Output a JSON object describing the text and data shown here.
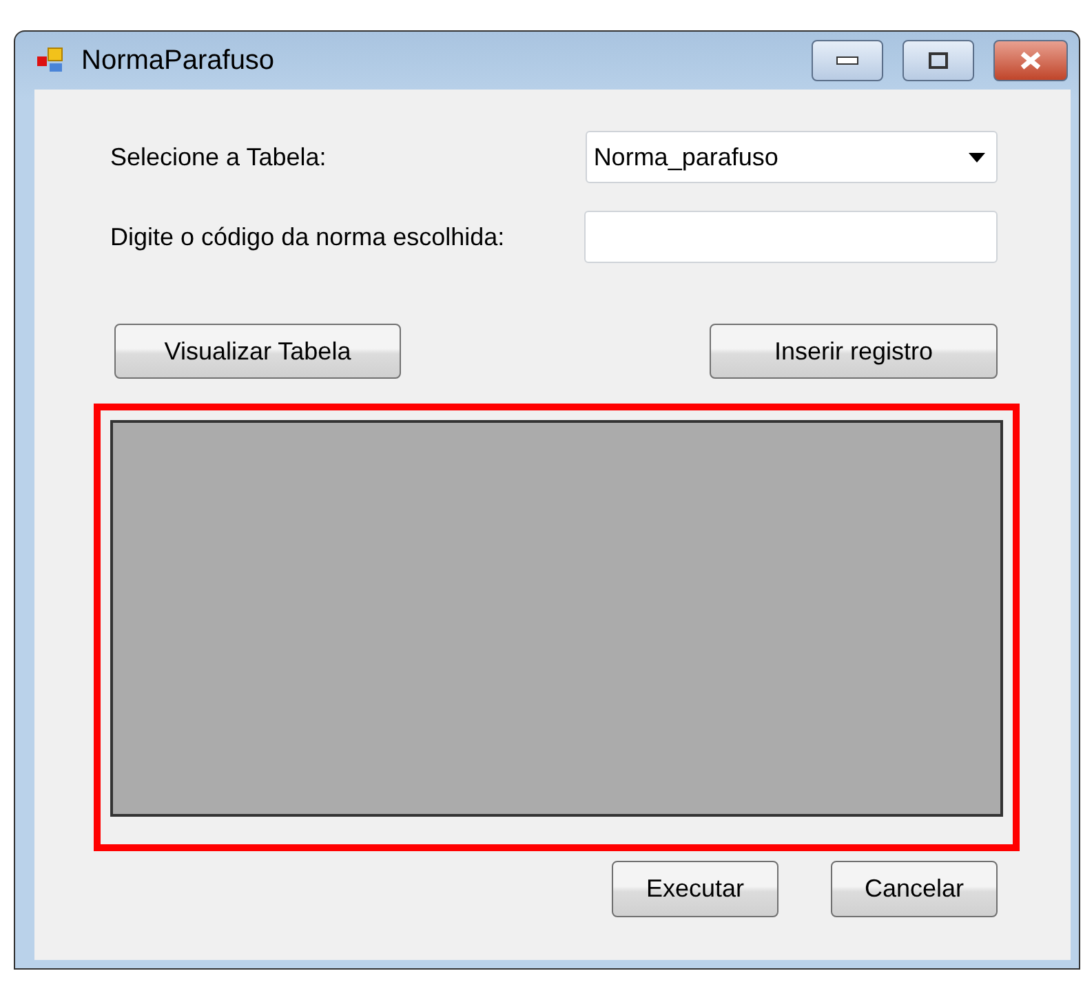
{
  "window": {
    "title": "NormaParafuso"
  },
  "fields": [
    {
      "kind": "combo",
      "label": "Selecione a Tabela:",
      "value": "Norma_parafuso"
    },
    {
      "kind": "text",
      "label": "Digite o código da norma escolhida:"
    }
  ],
  "action_buttons": [
    "Visualizar Tabela",
    "Inserir registro"
  ],
  "footer_buttons": [
    "Executar",
    "Cancelar"
  ]
}
